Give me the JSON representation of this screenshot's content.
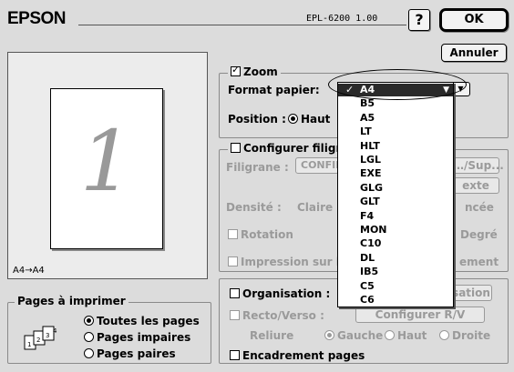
{
  "header": {
    "brand": "EPSON",
    "model": "EPL-6200  1.00",
    "help_label": "?",
    "ok_label": "OK",
    "annuler_label": "Annuler"
  },
  "preview": {
    "page_number": "1",
    "caption": "A4→A4"
  },
  "zoom": {
    "checkbox_label": "Zoom",
    "checked": true,
    "format_label": "Format papier:",
    "position_label": "Position :",
    "position_value": "Haut"
  },
  "paper_menu": {
    "selected": "A4",
    "options": [
      "A4",
      "B5",
      "A5",
      "LT",
      "HLT",
      "LGL",
      "EXE",
      "GLG",
      "GLT",
      "F4",
      "MON",
      "C10",
      "DL",
      "IB5",
      "C5",
      "C6"
    ]
  },
  "watermark": {
    "checkbox_label": "Configurer filigra",
    "filigrane_label": "Filigrane :",
    "filigrane_value": "CONFIDI",
    "sup_button": "…/Sup...",
    "texte_button": "exte",
    "densite_label": "Densité :",
    "claire_label": "Claire",
    "foncee_label": "ncée",
    "rotation_label": "Rotation",
    "degre_label": "Degré",
    "impression_label": "Impression sur la",
    "ement_label": "ement"
  },
  "organisation": {
    "checkbox_label": "Organisation :",
    "sation_button": "sation",
    "recto_label": "Recto/Verso :",
    "configurer_rv_button": "Configurer R/V",
    "reliure_label": "Reliure",
    "gauche_label": "Gauche",
    "haut_label": "Haut",
    "droite_label": "Droite",
    "encadrement_label": "Encadrement pages"
  },
  "pages": {
    "legend": "Pages à imprimer",
    "options": [
      "Toutes les pages",
      "Pages impaires",
      "Pages paires"
    ],
    "selected_index": 0
  }
}
